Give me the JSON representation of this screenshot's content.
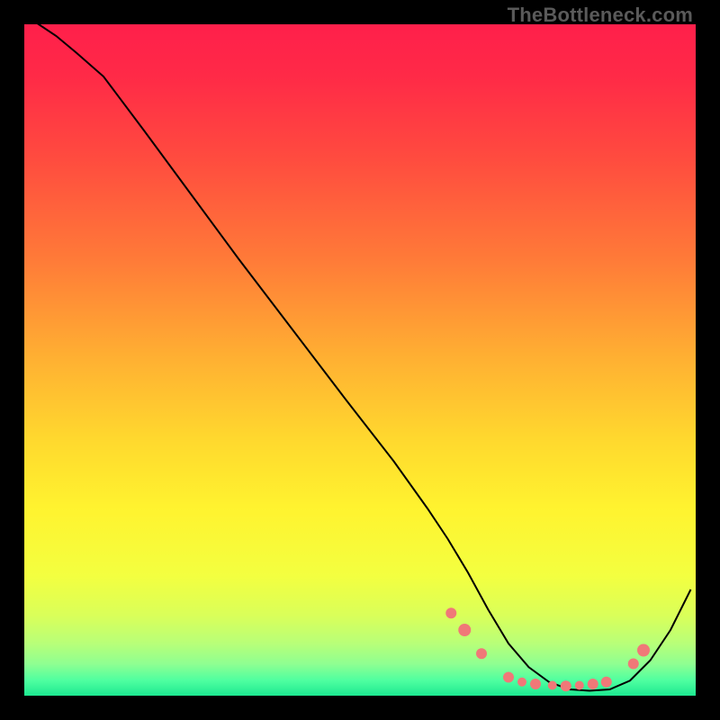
{
  "attribution": "TheBottleneck.com",
  "gradient_stops": [
    {
      "offset": 0.0,
      "color": "#ff1f4b"
    },
    {
      "offset": 0.08,
      "color": "#ff2a47"
    },
    {
      "offset": 0.2,
      "color": "#ff4b3f"
    },
    {
      "offset": 0.35,
      "color": "#ff7a38"
    },
    {
      "offset": 0.5,
      "color": "#ffb132"
    },
    {
      "offset": 0.62,
      "color": "#ffd92e"
    },
    {
      "offset": 0.72,
      "color": "#fff32f"
    },
    {
      "offset": 0.82,
      "color": "#f3ff40"
    },
    {
      "offset": 0.88,
      "color": "#d9ff5a"
    },
    {
      "offset": 0.92,
      "color": "#b8ff78"
    },
    {
      "offset": 0.95,
      "color": "#8fff91"
    },
    {
      "offset": 0.975,
      "color": "#4effa0"
    },
    {
      "offset": 1.0,
      "color": "#17e68f"
    }
  ],
  "chart_data": {
    "type": "line",
    "title": "",
    "xlabel": "",
    "ylabel": "",
    "xlim": [
      0,
      100
    ],
    "ylim": [
      0,
      100
    ],
    "grid": false,
    "legend": false,
    "series": [
      {
        "name": "bottleneck-curve",
        "x": [
          2,
          5,
          8,
          12,
          18,
          25,
          32,
          40,
          48,
          55,
          60,
          63,
          66,
          69,
          72,
          75,
          78,
          81,
          84,
          87,
          90,
          93,
          96,
          99
        ],
        "y": [
          100,
          98,
          95.5,
          92,
          84,
          74.5,
          65,
          54.5,
          44,
          35,
          28,
          23.5,
          18.5,
          13,
          8,
          4.5,
          2.3,
          1.2,
          1.0,
          1.2,
          2.5,
          5.5,
          10,
          16
        ]
      }
    ],
    "markers": {
      "name": "highlight-dots",
      "color": "#f07878",
      "points": [
        {
          "x": 63.5,
          "y": 12.5,
          "r": 6
        },
        {
          "x": 65.5,
          "y": 10.0,
          "r": 7
        },
        {
          "x": 68.0,
          "y": 6.5,
          "r": 6
        },
        {
          "x": 72.0,
          "y": 3.0,
          "r": 6
        },
        {
          "x": 74.0,
          "y": 2.3,
          "r": 5
        },
        {
          "x": 76.0,
          "y": 2.0,
          "r": 6
        },
        {
          "x": 78.5,
          "y": 1.8,
          "r": 5
        },
        {
          "x": 80.5,
          "y": 1.7,
          "r": 6
        },
        {
          "x": 82.5,
          "y": 1.8,
          "r": 5
        },
        {
          "x": 84.5,
          "y": 2.0,
          "r": 6
        },
        {
          "x": 86.5,
          "y": 2.3,
          "r": 6
        },
        {
          "x": 90.5,
          "y": 5.0,
          "r": 6
        },
        {
          "x": 92.0,
          "y": 7.0,
          "r": 7
        }
      ]
    }
  }
}
